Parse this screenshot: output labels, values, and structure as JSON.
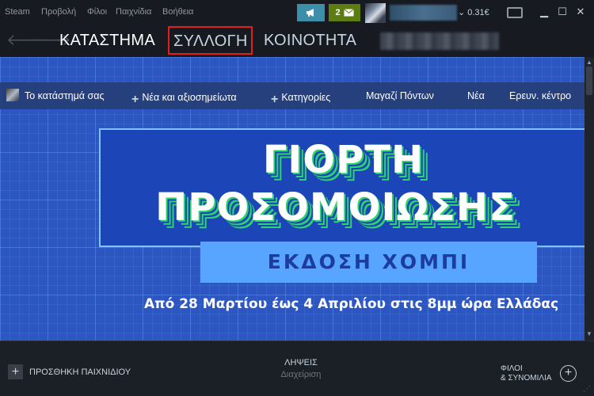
{
  "menu": {
    "items": [
      "Steam",
      "Προβολή",
      "Φίλοι",
      "Παιχνίδια",
      "Βοήθεια"
    ]
  },
  "topbar": {
    "announce_icon": "megaphone-icon",
    "notifications_count": "2",
    "notifications_icon": "envelope-icon",
    "wallet_balance": "0.31€",
    "dropdown_icon": "chevron-down-icon"
  },
  "nav": {
    "back_icon": "arrow-left-icon",
    "forward_icon": "arrow-right-icon",
    "tabs": [
      {
        "label": "ΚΑΤΑΣΤΗΜΑ"
      },
      {
        "label": "ΣΥΛΛΟΓΗ"
      },
      {
        "label": "ΚΟΙΝΟΤΗΤΑ"
      }
    ]
  },
  "store_nav": {
    "items": [
      {
        "label": "Το κατάστημά σας"
      },
      {
        "label": "Νέα και αξιοσημείωτα"
      },
      {
        "label": "Κατηγορίες"
      },
      {
        "label": "Μαγαζί Πόντων"
      },
      {
        "label": "Νέα"
      },
      {
        "label": "Ερευν. κέντρο"
      }
    ]
  },
  "banner": {
    "title_line1": "ΓΙΟΡΤΗ",
    "title_line2": "ΠΡΟΣΟΜΟΙΩΣΗΣ",
    "edition": "ΕΚΔΟΣΗ ΧΟΜΠΙ",
    "dates": "Από 28 Μαρτίου έως 4 Απριλίου στις 8μμ ώρα Ελλάδας"
  },
  "bottom": {
    "add_game": "ΠΡΟΣΘΗΚΗ ΠΑΙΧΝΙΔΙΟΥ",
    "downloads_title": "ΛΗΨΕΙΣ",
    "downloads_sub": "Διαχείριση",
    "friends_line1": "ΦΙΛΟΙ",
    "friends_line2": "& ΣΥΝΟΜΙΛΙΑ"
  },
  "colors": {
    "accent_green": "#5c7e10",
    "announce_blue": "#3d8ea8",
    "highlight_red": "#e31e1e",
    "banner_blue": "#2c56c2"
  }
}
